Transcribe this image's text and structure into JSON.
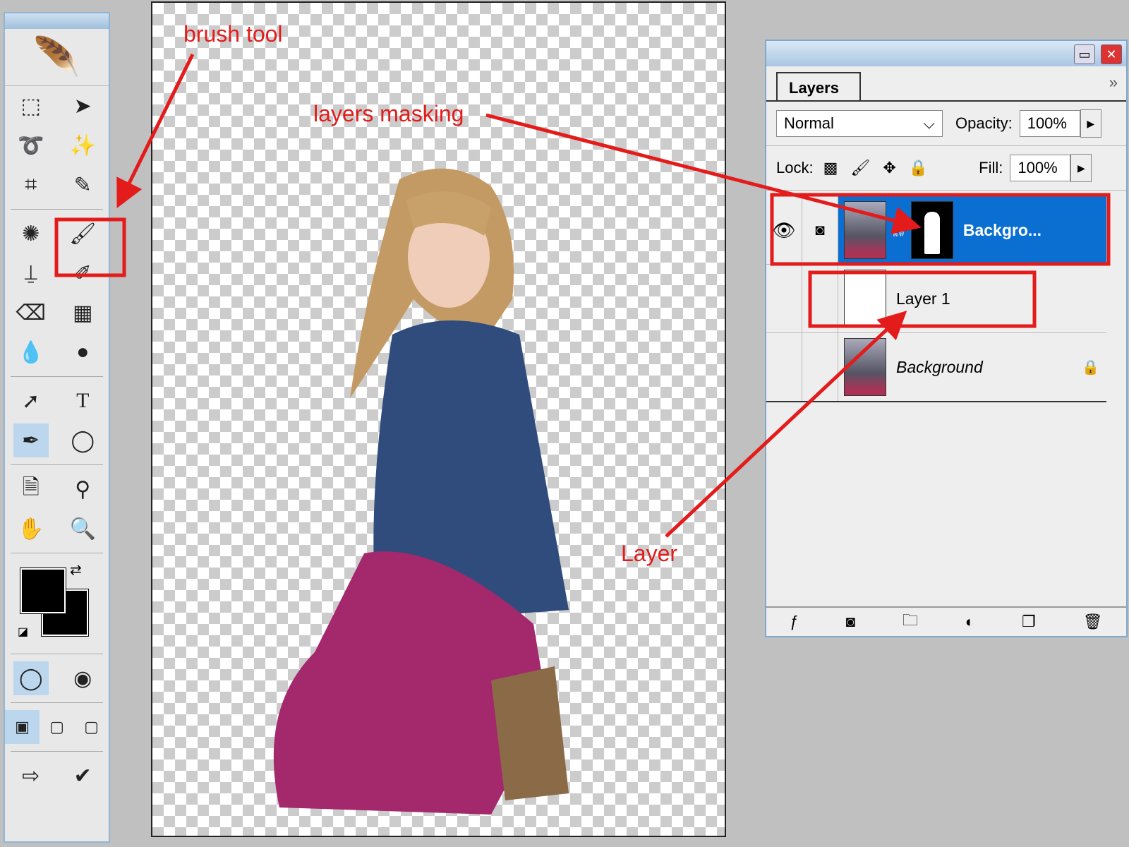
{
  "toolbox": {
    "tools": [
      [
        "marquee-icon",
        "move-icon"
      ],
      [
        "lasso-icon",
        "magic-wand-icon"
      ],
      [
        "crop-icon",
        "slice-icon"
      ],
      [
        "healing-icon",
        "brush-icon"
      ],
      [
        "stamp-icon",
        "history-brush-icon"
      ],
      [
        "eraser-icon",
        "gradient-icon"
      ],
      [
        "blur-icon",
        "dodge-icon"
      ],
      [
        "path-select-icon",
        "type-icon"
      ],
      [
        "pen-icon",
        "shape-icon"
      ],
      [
        "notes-icon",
        "eyedropper-icon"
      ],
      [
        "hand-icon",
        "zoom-icon"
      ]
    ],
    "glyphs": {
      "type": "T"
    },
    "foreground": "#000000",
    "background": "#000000"
  },
  "layers_panel": {
    "tab": "Layers",
    "blend_mode": "Normal",
    "opacity_label": "Opacity:",
    "opacity": "100%",
    "lock_label": "Lock:",
    "fill_label": "Fill:",
    "fill": "100%",
    "layers": [
      {
        "name": "Backgro...",
        "selected": true,
        "visible": true,
        "has_mask": true
      },
      {
        "name": "Layer 1",
        "selected": false
      },
      {
        "name": "Background",
        "italic": true,
        "locked": true
      }
    ]
  },
  "annotations": {
    "brush_tool": "brush tool",
    "layers_masking": "layers masking",
    "layer": "Layer",
    "color": "#e31b1b"
  },
  "accent": "#0a6fd0"
}
